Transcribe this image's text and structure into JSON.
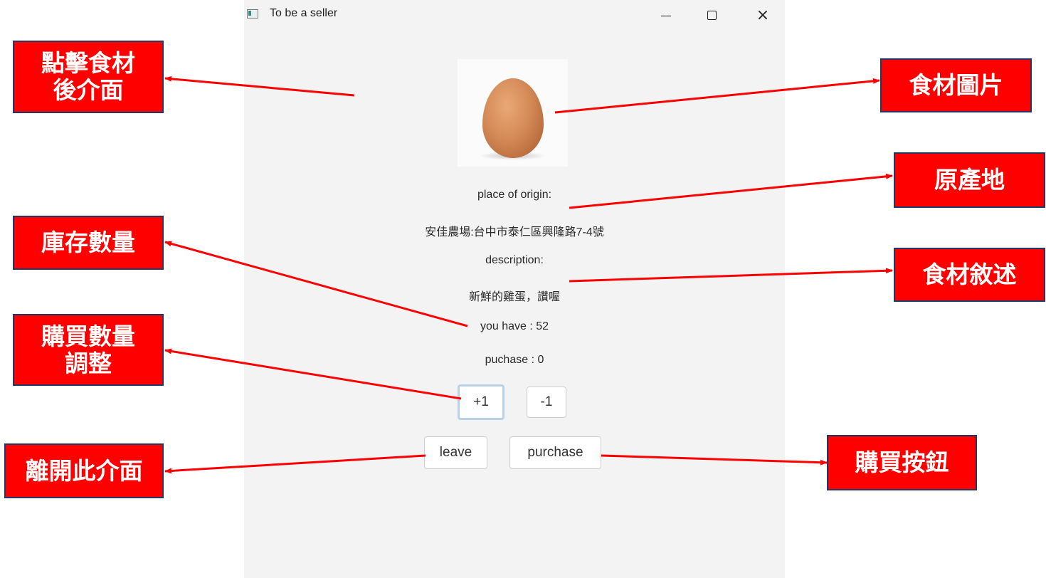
{
  "window": {
    "title": "To be a seller",
    "controls": {
      "minimize": "minimize-icon",
      "maximize": "maximize-icon",
      "close": "×"
    }
  },
  "product": {
    "image": "egg-photo",
    "origin_label": "place of origin:",
    "origin_value": "安佳農場:台中市泰仁區興隆路7-4號",
    "description_label": "description:",
    "description_value": "新鮮的雞蛋，讚喔",
    "stock_text": "you have : 52",
    "purchase_text": "puchase : 0"
  },
  "buttons": {
    "increment": "+1",
    "decrement": "-1",
    "leave": "leave",
    "purchase": "purchase"
  },
  "annotations": {
    "interface_after_click": [
      "點擊食材",
      "後介面"
    ],
    "ingredient_image": "食材圖片",
    "place_of_origin": "原產地",
    "stock_quantity": "庫存數量",
    "ingredient_description": "食材敘述",
    "adjust_quantity": [
      "購買數量",
      "調整"
    ],
    "leave_interface": "離開此介面",
    "purchase_button": "購買按鈕"
  },
  "colors": {
    "annotation_bg": "#ff0000",
    "annotation_border": "#1f3864",
    "arrow": "#ff0000",
    "window_bg": "#f3f3f3"
  }
}
